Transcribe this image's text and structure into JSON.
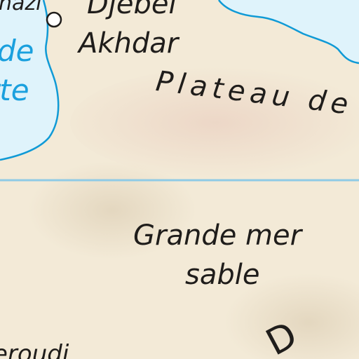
{
  "colors": {
    "sea": "#dff3fb",
    "sea_deep": "#c7e9f8",
    "coast": "#0f9ad6",
    "land_light": "#f3ead7",
    "land_warm": "#ecd6c6",
    "land_shadow": "#e2d5bd",
    "parallel": "#8fcbe6",
    "water_label": "#1aa0de",
    "label": "#1f1d1b"
  },
  "labels": {
    "city_fragment": "nazi",
    "mountain_line1": "Djebel",
    "mountain_line2": "Akhdar",
    "gulf_line1": "de",
    "gulf_line2": "rte",
    "plateau": "Plateau de",
    "erg_line1": "Grande mer",
    "erg_line2": "sable",
    "bottom_left_fragment": "eroudi",
    "bottom_right_fragment": "D"
  },
  "icons": {
    "city_marker": "city-dot-icon"
  }
}
